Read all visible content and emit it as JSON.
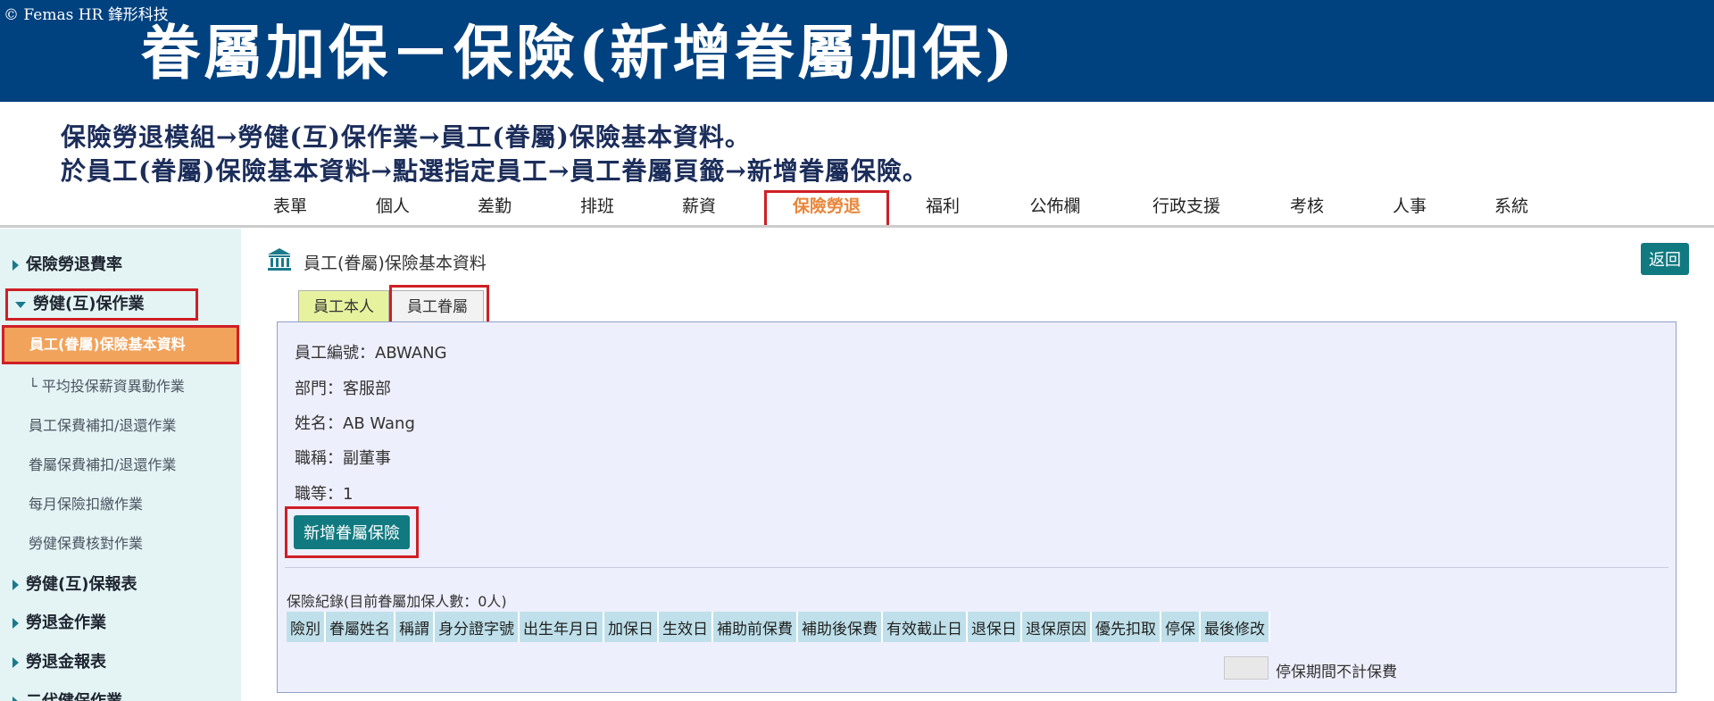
{
  "banner": {
    "copyright": "© Femas HR 鋒形科技",
    "title": "眷屬加保－保險(新增眷屬加保)"
  },
  "instructions": [
    "保險勞退模組→勞健(互)保作業→員工(眷屬)保險基本資料。",
    "於員工(眷屬)保險基本資料→點選指定員工→員工眷屬頁籤→新增眷屬保險。"
  ],
  "topnav": [
    {
      "label": "表單"
    },
    {
      "label": "個人"
    },
    {
      "label": "差勤"
    },
    {
      "label": "排班"
    },
    {
      "label": "薪資"
    },
    {
      "label": "保險勞退",
      "active": true
    },
    {
      "label": "福利"
    },
    {
      "label": "公佈欄"
    },
    {
      "label": "行政支援"
    },
    {
      "label": "考核"
    },
    {
      "label": "人事"
    },
    {
      "label": "系統"
    }
  ],
  "sidebar": {
    "items": [
      {
        "type": "group",
        "label": "保險勞退費率",
        "expanded": false
      },
      {
        "type": "group",
        "label": "勞健(互)保作業",
        "expanded": true
      },
      {
        "type": "sub",
        "label": "員工(眷屬)保險基本資料",
        "active": true
      },
      {
        "type": "sub",
        "label": "└ 平均投保薪資異動作業"
      },
      {
        "type": "sub",
        "label": "員工保費補扣/退還作業"
      },
      {
        "type": "sub",
        "label": "眷屬保費補扣/退還作業"
      },
      {
        "type": "sub",
        "label": "每月保險扣繳作業"
      },
      {
        "type": "sub",
        "label": "勞健保費核對作業"
      },
      {
        "type": "group",
        "label": "勞健(互)保報表",
        "expanded": false
      },
      {
        "type": "group",
        "label": "勞退金作業",
        "expanded": false
      },
      {
        "type": "group",
        "label": "勞退金報表",
        "expanded": false
      },
      {
        "type": "group",
        "label": "二代健保作業",
        "expanded": false
      }
    ]
  },
  "main": {
    "page_title": "員工(眷屬)保險基本資料",
    "back_label": "返回",
    "tabs": {
      "self": "員工本人",
      "dependent": "員工眷屬"
    },
    "info": {
      "emp_no": "員工編號：ABWANG",
      "dept": "部門：客服部",
      "name": "姓名：AB Wang",
      "title": "職稱：副董事",
      "grade": "職等：1"
    },
    "add_button": "新增眷屬保險",
    "records_title": "保險紀錄(目前眷屬加保人數：0人)",
    "columns": [
      "險別",
      "眷屬姓名",
      "稱謂",
      "身分證字號",
      "出生年月日",
      "加保日",
      "生效日",
      "補助前保費",
      "補助後保費",
      "有效截止日",
      "退保日",
      "退保原因",
      "優先扣取",
      "停保",
      "最後修改"
    ],
    "legend": "停保期間不計保費"
  },
  "colors": {
    "banner": "#00417f",
    "accent_teal": "#107a80",
    "highlight_red": "#cf1f25",
    "active_orange": "#e9863a",
    "sidebar_bg": "#e4f4f5",
    "panel_bg": "#eeeffc",
    "table_header": "#bfe0ea"
  },
  "icons": {
    "page_icon": "bank-icon",
    "group_expand": "caret-right-icon",
    "group_collapse": "caret-down-icon"
  }
}
